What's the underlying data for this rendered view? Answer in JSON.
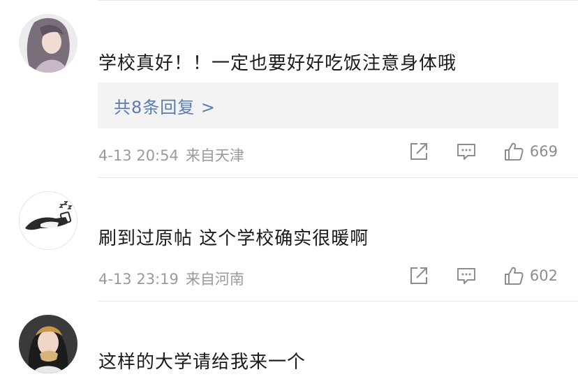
{
  "comments": [
    {
      "text": "学校真好！！一定也要好好吃饭注意身体哦",
      "replies_label": "共8条回复 >",
      "time": "4-13 20:54",
      "location": "来自天津",
      "likes": "669",
      "avatar_icon": "user-avatar-girl-long-hair"
    },
    {
      "text": "刷到过原帖 这个学校确实很暖啊",
      "time": "4-13 23:19",
      "location": "来自河南",
      "likes": "602",
      "avatar_icon": "user-avatar-sleeping-cat"
    },
    {
      "text": "这样的大学请给我来一个",
      "avatar_icon": "user-avatar-girl-eating"
    }
  ],
  "icons": {
    "share": "share-icon",
    "comment": "comment-icon",
    "like": "thumbs-up-icon"
  },
  "colors": {
    "reply_link": "#5a7bb0",
    "meta_text": "#9a9a9a",
    "reply_box_bg": "#f3f3f3"
  }
}
